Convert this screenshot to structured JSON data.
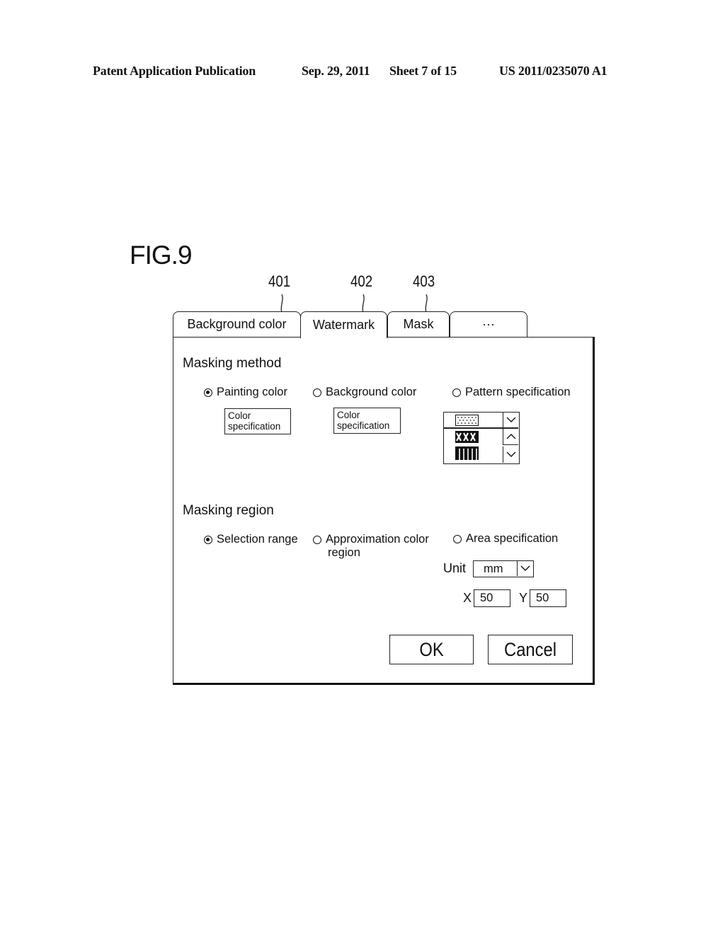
{
  "header": {
    "publication": "Patent Application Publication",
    "date": "Sep. 29, 2011",
    "sheet": "Sheet 7 of 15",
    "number": "US 2011/0235070 A1"
  },
  "figure": {
    "label": "FIG.9",
    "references": [
      "401",
      "402",
      "403"
    ]
  },
  "tabs": [
    {
      "label": "Background color",
      "active": false
    },
    {
      "label": "Watermark",
      "active": true
    },
    {
      "label": "Mask",
      "active": false
    },
    {
      "label": "···",
      "active": false
    }
  ],
  "masking_method": {
    "title": "Masking method",
    "options": [
      {
        "label": "Painting color",
        "selected": true
      },
      {
        "label": "Background color",
        "selected": false
      },
      {
        "label": "Pattern specification",
        "selected": false
      }
    ],
    "color_button_line1": "Color",
    "color_button_line2": "specification",
    "patterns": [
      "dotted-pattern",
      "cross-hatch-pattern",
      "vertical-stripe-pattern"
    ]
  },
  "masking_region": {
    "title": "Masking region",
    "options": [
      {
        "label": "Selection range",
        "selected": true
      },
      {
        "label": "Approximation color",
        "label2": "region",
        "selected": false
      },
      {
        "label": "Area specification",
        "selected": false
      }
    ],
    "unit_label": "Unit",
    "unit_value": "mm",
    "x_label": "X",
    "x_value": "50",
    "y_label": "Y",
    "y_value": "50"
  },
  "buttons": {
    "ok": "OK",
    "cancel": "Cancel"
  }
}
